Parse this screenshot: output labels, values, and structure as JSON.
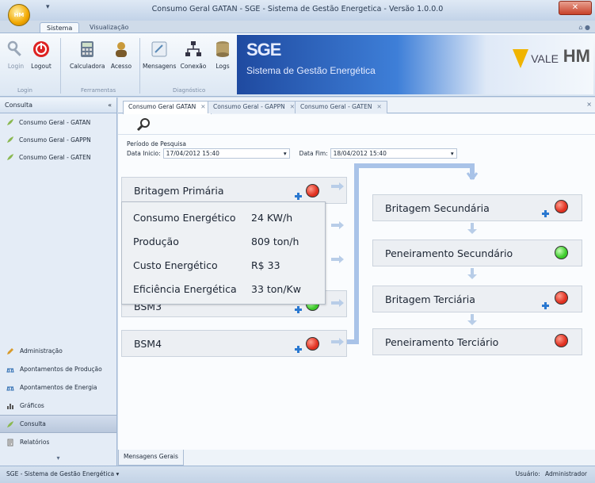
{
  "window": {
    "title": "Consumo Geral GATAN - SGE - Sistema de Gestão Energetica - Versão 1.0.0.0",
    "orb_label": "HM",
    "close_glyph": "✕"
  },
  "ribbon": {
    "tabs": [
      {
        "label": "Sistema",
        "active": true
      },
      {
        "label": "Visualização",
        "active": false
      }
    ],
    "buttons": {
      "login": "Login",
      "logout": "Logout",
      "calculadora": "Calculadora",
      "acesso": "Acesso",
      "mensagens": "Mensagens",
      "conexao": "Conexão",
      "logs": "Logs"
    },
    "groups": {
      "login": "Login",
      "ferramentas": "Ferramentas",
      "diagnostico": "Diagnóstico"
    },
    "banner": {
      "title": "SGE",
      "subtitle": "Sistema de Gestão Energética",
      "vale": "VALE",
      "hm": "HM"
    }
  },
  "nav": {
    "header": "Consulta",
    "collapse_glyph": "«",
    "items": [
      {
        "label": "Consumo Geral - GATAN"
      },
      {
        "label": "Consumo Geral - GAPPN"
      },
      {
        "label": "Consumo Geral - GATEN"
      }
    ],
    "bottom": [
      {
        "label": "Administração",
        "icon": "pencil-icon"
      },
      {
        "label": "Apontamentos de Produção",
        "icon": "scale-icon"
      },
      {
        "label": "Apontamentos de Energia",
        "icon": "scale-icon"
      },
      {
        "label": "Gráficos",
        "icon": "chart-icon"
      },
      {
        "label": "Consulta",
        "icon": "leaf-icon",
        "selected": true
      },
      {
        "label": "Relatórios",
        "icon": "report-icon"
      }
    ],
    "footer_glyph": "▾"
  },
  "doc_tabs": [
    {
      "label": "Consumo Geral GATAN",
      "active": true
    },
    {
      "label": "Consumo Geral - GAPPN",
      "active": false
    },
    {
      "label": "Consumo Geral - GATEN",
      "active": false
    }
  ],
  "doc_close": "×",
  "filter": {
    "period_label": "Período de Pesquisa",
    "start_label": "Data Inicio:",
    "start_value": "17/04/2012 15:40",
    "end_label": "Data Fim:",
    "end_value": "18/04/2012 15:40"
  },
  "left_flow": [
    {
      "label": "Britagem Primária",
      "status": "red"
    },
    {
      "label": "BSM3",
      "status": "green"
    },
    {
      "label": "BSM4",
      "status": "red"
    }
  ],
  "right_flow": [
    {
      "label": "Britagem Secundária",
      "status": "red"
    },
    {
      "label": "Peneiramento Secundário",
      "status": "green"
    },
    {
      "label": "Britagem Terciária",
      "status": "red"
    },
    {
      "label": "Peneiramento Terciário",
      "status": "red"
    }
  ],
  "tooltip": {
    "rows": [
      {
        "label": "Consumo Energético",
        "value": "24 KW/h"
      },
      {
        "label": "Produção",
        "value": "809 ton/h"
      },
      {
        "label": "Custo Energético",
        "value": "R$ 33"
      },
      {
        "label": "Eficiência Energética",
        "value": "33 ton/Kw"
      }
    ]
  },
  "messages_tab": "Mensagens Gerais",
  "statusbar": {
    "left": "SGE - Sistema de Gestão Energética ▾",
    "user_label": "Usuário:",
    "user_value": "Administrador"
  },
  "colors": {
    "status_red": "#e03020",
    "status_green": "#3ccb2a",
    "accent_blue": "#2a78d0"
  }
}
